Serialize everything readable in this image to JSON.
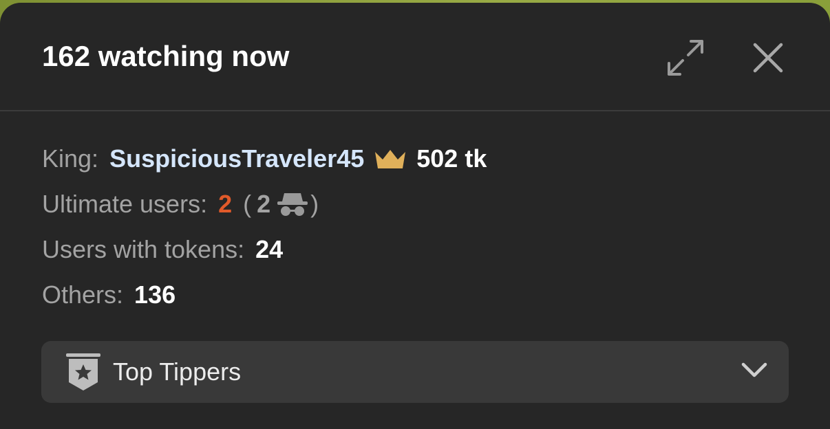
{
  "panel": {
    "title": "162 watching now"
  },
  "header_actions": {
    "expand_icon": "expand-arrows-icon",
    "close_icon": "close-icon"
  },
  "stats": {
    "king_label": "King:",
    "king_name": "SuspiciousTraveler45",
    "king_tokens": "502 tk",
    "ultimate_label": "Ultimate users:",
    "ultimate_count": "2",
    "ultimate_paren_open": "(",
    "ultimate_hidden_count": "2",
    "ultimate_paren_close": ")",
    "tokens_label": "Users with tokens:",
    "tokens_count": "24",
    "others_label": "Others:",
    "others_count": "136"
  },
  "top_tippers": {
    "label": "Top Tippers",
    "icon": "star-badge-icon",
    "chevron": "chevron-down-icon"
  },
  "colors": {
    "panel_bg": "#262626",
    "king_name": "#d5e6fb",
    "crown": "#e0b05a",
    "ultimate_count": "#e15a2a",
    "dropdown_bg": "#393939"
  }
}
